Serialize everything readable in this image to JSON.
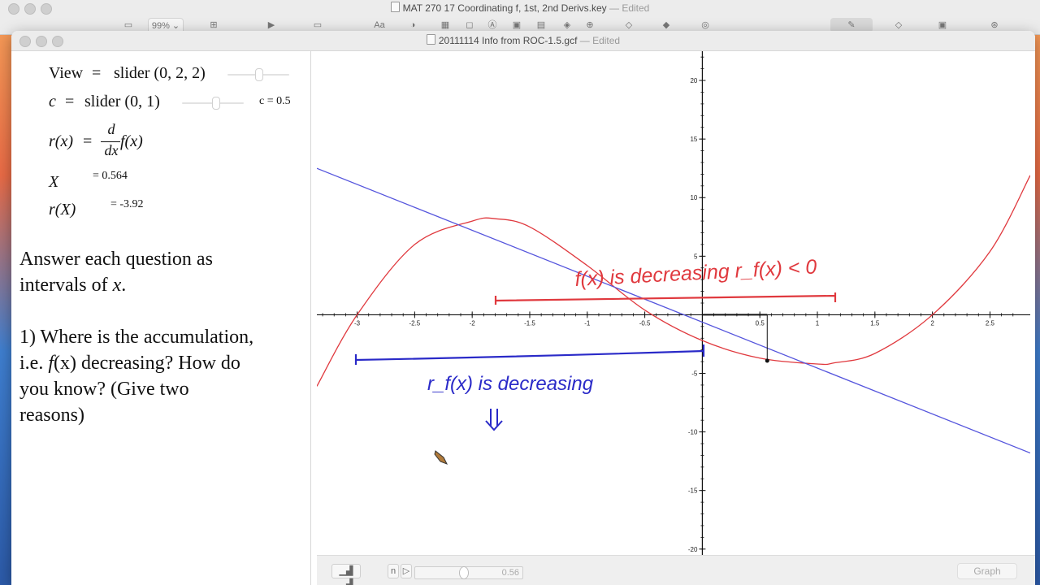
{
  "desktop": {
    "window_title": "MAT 270 17 Coordinating f, 1st, 2nd Derivs.key",
    "edited_label": "— Edited",
    "zoom": "99%"
  },
  "window": {
    "title": "20111114 Info from ROC-1.5.gcf",
    "edited_label": "— Edited"
  },
  "equations": {
    "view_lhs": "View",
    "view_rhs": "slider (0, 2, 2)",
    "c_lhs": "c",
    "c_rhs": "slider (0, 1)",
    "c_value": "c = 0.5",
    "r_lhs": "r(x)",
    "r_num": "d",
    "r_den": "dx",
    "r_fn": "f(x)",
    "X_lhs": "X",
    "X_value": "= 0.564",
    "rX_lhs": "r(X)",
    "rX_value": "= -3.92",
    "eq_sign": "="
  },
  "prose": {
    "line1": "Answer each question as",
    "line2a": "intervals of ",
    "line2b": "x",
    "line2c": ".",
    "q1a": "1) Where is the accumulation,",
    "q1b1": "i.e. ",
    "q1b2": "f",
    "q1b3": "(x) decreasing?  How do",
    "q1c": "you know?  (Give two",
    "q1d": "reasons)"
  },
  "chart_data": {
    "type": "line",
    "xlim": [
      -3.35,
      2.85
    ],
    "ylim": [
      -20.5,
      22.5
    ],
    "x_ticks": [
      "-3",
      "-2.5",
      "-2",
      "-1.5",
      "-1",
      "-0.5",
      "0.5",
      "1",
      "1.5",
      "2",
      "2.5"
    ],
    "y_ticks": [
      "20",
      "15",
      "10",
      "5",
      "-5",
      "-10",
      "-15",
      "-20"
    ],
    "point": {
      "x": 0.564,
      "y": -3.92
    },
    "series": [
      {
        "color": "#e0393e",
        "x": [
          -3.35,
          -3,
          -2.5,
          -2,
          -1.8,
          -1.5,
          -1,
          -0.5,
          0,
          0.5,
          1,
          1.15,
          1.5,
          2,
          2.5,
          2.85
        ],
        "y": [
          -6.1,
          0,
          6,
          8,
          8.2,
          7.5,
          4.2,
          0.4,
          -2.2,
          -3.7,
          -4.2,
          -4.1,
          -3.3,
          0,
          5.4,
          11.9
        ]
      },
      {
        "color": "#5555dd",
        "x": [
          -3.35,
          2.85
        ],
        "y": [
          12.5,
          -11.8
        ]
      }
    ],
    "annotations": [
      {
        "text": "f(x) is decreasing  r_f(x) < 0",
        "color": "#e0393e"
      },
      {
        "text": "r_f(x) is decreasing",
        "color": "#2a2ac8"
      }
    ]
  },
  "bottom_bar": {
    "n_label": "n",
    "play_label": "▷",
    "slider_value": "0.56",
    "slider_fraction": 0.45,
    "graph_button": "Graph"
  }
}
